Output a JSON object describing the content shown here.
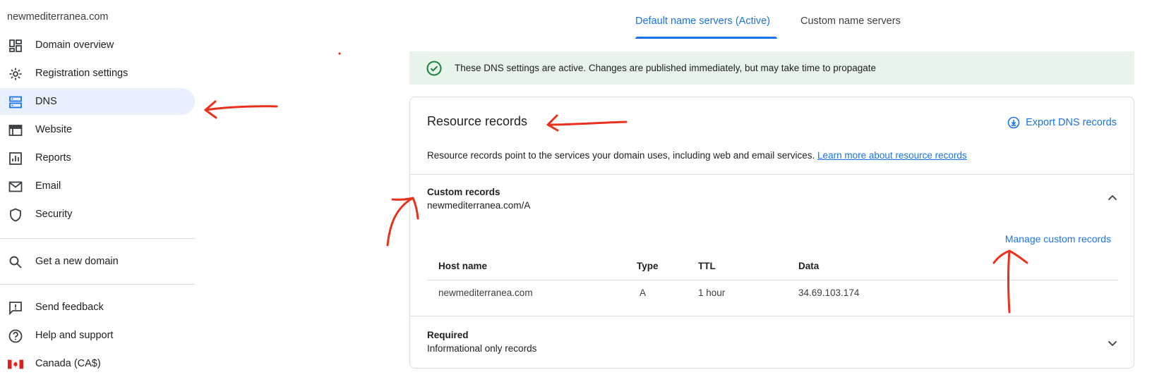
{
  "sidebar": {
    "domain": "newmediterranea.com",
    "items": [
      {
        "label": "Domain overview",
        "icon": "dashboard-icon"
      },
      {
        "label": "Registration settings",
        "icon": "gear-icon"
      },
      {
        "label": "DNS",
        "icon": "dns-icon",
        "active": true
      },
      {
        "label": "Website",
        "icon": "website-icon"
      },
      {
        "label": "Reports",
        "icon": "reports-icon"
      },
      {
        "label": "Email",
        "icon": "email-icon"
      },
      {
        "label": "Security",
        "icon": "shield-icon"
      }
    ],
    "get_domain": "Get a new domain",
    "footer": [
      {
        "label": "Send feedback",
        "icon": "feedback-icon"
      },
      {
        "label": "Help and support",
        "icon": "help-icon"
      },
      {
        "label": "Canada (CA$)",
        "icon": "canada-flag-icon"
      }
    ]
  },
  "tabs": [
    {
      "label": "Default name servers (Active)",
      "active": true
    },
    {
      "label": "Custom name servers",
      "active": false
    }
  ],
  "banner": {
    "message": "These DNS settings are active. Changes are published immediately, but may take time to propagate"
  },
  "resource_records": {
    "title": "Resource records",
    "export_label": "Export DNS records",
    "description": "Resource records point to the services your domain uses, including web and email services.",
    "learn_more": "Learn more about resource records"
  },
  "custom_records": {
    "title": "Custom records",
    "subtitle": "newmediterranea.com/A",
    "manage_label": "Manage custom records",
    "columns": [
      "Host name",
      "Type",
      "TTL",
      "Data"
    ],
    "rows": [
      [
        "newmediterranea.com",
        "A",
        "1 hour",
        "34.69.103.174"
      ]
    ]
  },
  "required": {
    "title": "Required",
    "subtitle": "Informational only records"
  },
  "colors": {
    "accent": "#1a73e8",
    "banner_bg": "#e6f4ea",
    "success": "#188038",
    "annotation": "#e8321e"
  }
}
